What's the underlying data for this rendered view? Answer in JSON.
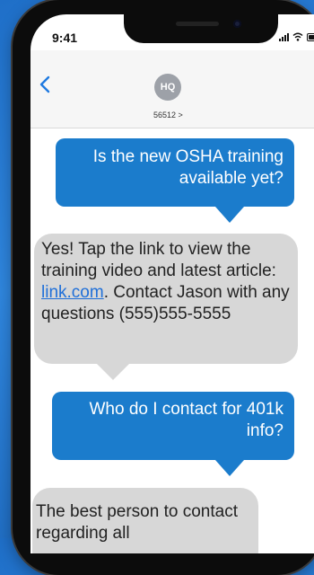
{
  "status_bar": {
    "time": "9:41"
  },
  "header": {
    "back_icon": "chevron-left-icon",
    "avatar_initials": "HQ",
    "contact_number": "56512 >"
  },
  "messages": [
    {
      "sender": "me",
      "text": "Is the new OSHA training available yet?"
    },
    {
      "sender": "them",
      "text_before_link": "Yes! Tap the link to view the training video and latest article: ",
      "link_text": "link.com",
      "text_after_link": ". Contact Jason with any questions (555)555-5555"
    },
    {
      "sender": "me",
      "text": "Who do I contact for 401k info?"
    },
    {
      "sender": "them",
      "text": "The best person to contact regarding all"
    }
  ],
  "colors": {
    "background": "#2f86de",
    "sent_bubble": "#1b7ccc",
    "received_bubble": "#d7d7d7",
    "link": "#1f6fd8"
  }
}
